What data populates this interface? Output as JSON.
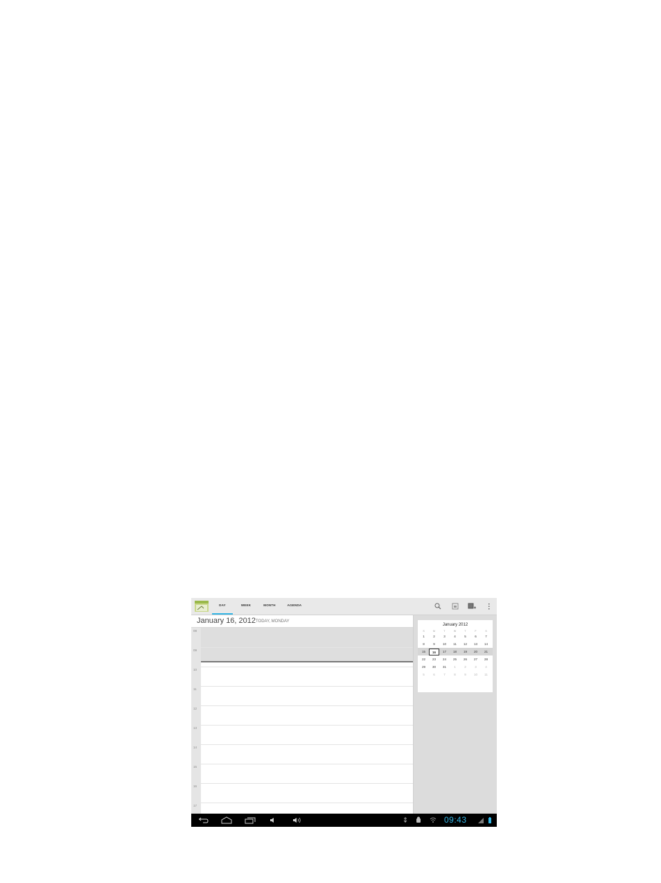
{
  "tabs": [
    {
      "label": "DAY",
      "selected": true
    },
    {
      "label": "WEEK",
      "selected": false
    },
    {
      "label": "MONTH",
      "selected": false
    },
    {
      "label": "AGENDA",
      "selected": false
    }
  ],
  "actions": {
    "icons": [
      "search-icon",
      "calendar-today-icon",
      "new-event-icon",
      "overflow-menu-icon"
    ]
  },
  "date_header": {
    "title": "January 16, 2012",
    "subtitle": "TODAY, MONDAY"
  },
  "hours": [
    "08",
    "09",
    "10",
    "11",
    "12",
    "13",
    "14",
    "15",
    "16",
    "17"
  ],
  "mini_calendar": {
    "title": "January 2012",
    "weekdays": [
      "S",
      "M",
      "T",
      "W",
      "T",
      "F",
      "S"
    ],
    "weeks": [
      [
        "1",
        "2",
        "3",
        "4",
        "5",
        "6",
        "7"
      ],
      [
        "8",
        "9",
        "10",
        "11",
        "12",
        "13",
        "14"
      ],
      [
        "15",
        "16",
        "17",
        "18",
        "19",
        "20",
        "21"
      ],
      [
        "22",
        "23",
        "24",
        "25",
        "26",
        "27",
        "28"
      ],
      [
        "29",
        "30",
        "31",
        "1",
        "2",
        "3",
        "4"
      ],
      [
        "5",
        "6",
        "7",
        "8",
        "9",
        "10",
        "11"
      ]
    ],
    "today": "16"
  },
  "status": {
    "time": "09:43"
  },
  "colors": {
    "accent": "#33b5e5",
    "navbar": "#000000"
  }
}
